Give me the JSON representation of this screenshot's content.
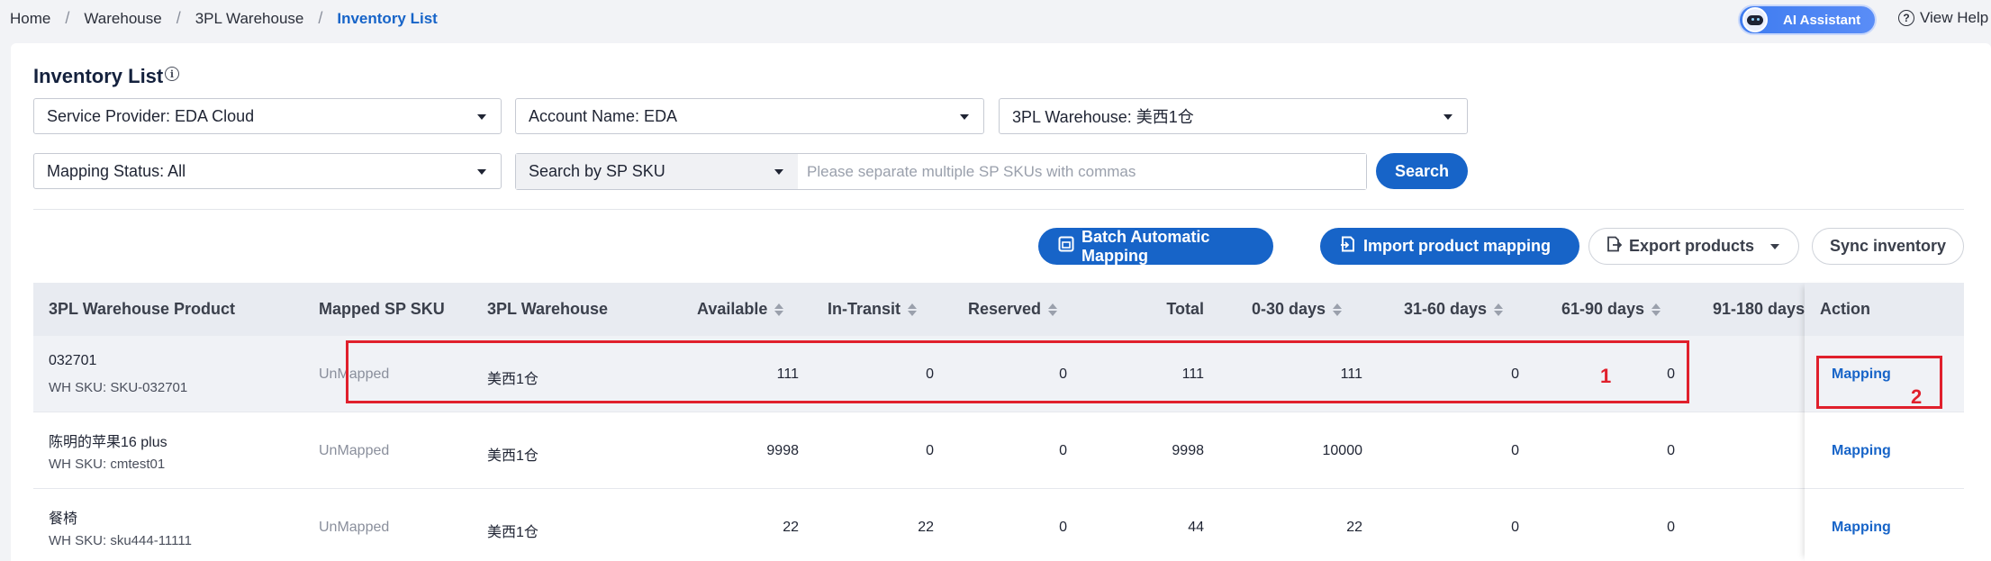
{
  "breadcrumb": [
    "Home",
    "Warehouse",
    "3PL Warehouse",
    "Inventory List"
  ],
  "header": {
    "ai_assistant": "AI Assistant",
    "view_help": "View Help"
  },
  "page": {
    "title": "Inventory List"
  },
  "filters": {
    "service_provider": "Service Provider: EDA Cloud",
    "account_name": "Account Name: EDA",
    "warehouse": "3PL Warehouse: 美西1仓",
    "mapping_status": "Mapping Status: All",
    "search_type": "Search by SP SKU",
    "search_placeholder": "Please separate multiple SP SKUs with commas",
    "search_button": "Search"
  },
  "toolbar": {
    "batch_mapping": "Batch Automatic Mapping",
    "import_mapping": "Import product mapping",
    "export_products": "Export products",
    "sync_inventory": "Sync inventory"
  },
  "table": {
    "columns": [
      "3PL Warehouse Product",
      "Mapped SP SKU",
      "3PL Warehouse",
      "Available",
      "In-Transit",
      "Reserved",
      "Total",
      "0-30 days",
      "31-60 days",
      "61-90 days",
      "91-180 days",
      "Action"
    ],
    "rows": [
      {
        "product": "032701",
        "wh_sku": "WH SKU: SKU-032701",
        "mapped": "UnMapped",
        "warehouse": "美西1仓",
        "available": "111",
        "in_transit": "0",
        "reserved": "0",
        "total": "111",
        "d0_30": "111",
        "d31_60": "0",
        "d61_90": "0",
        "action": "Mapping"
      },
      {
        "product": "陈明的苹果16 plus",
        "wh_sku": "WH SKU: cmtest01",
        "mapped": "UnMapped",
        "warehouse": "美西1仓",
        "available": "9998",
        "in_transit": "0",
        "reserved": "0",
        "total": "9998",
        "d0_30": "10000",
        "d31_60": "0",
        "d61_90": "0",
        "action": "Mapping"
      },
      {
        "product": "餐椅",
        "wh_sku": "WH SKU: sku444-11111",
        "mapped": "UnMapped",
        "warehouse": "美西1仓",
        "available": "22",
        "in_transit": "22",
        "reserved": "0",
        "total": "44",
        "d0_30": "22",
        "d31_60": "0",
        "d61_90": "0",
        "action": "Mapping"
      }
    ]
  },
  "annotations": {
    "label1": "1",
    "label2": "2",
    "color": "#e0202c"
  },
  "colors": {
    "primary": "#1764c8",
    "header_bg": "#e8ebf1"
  }
}
